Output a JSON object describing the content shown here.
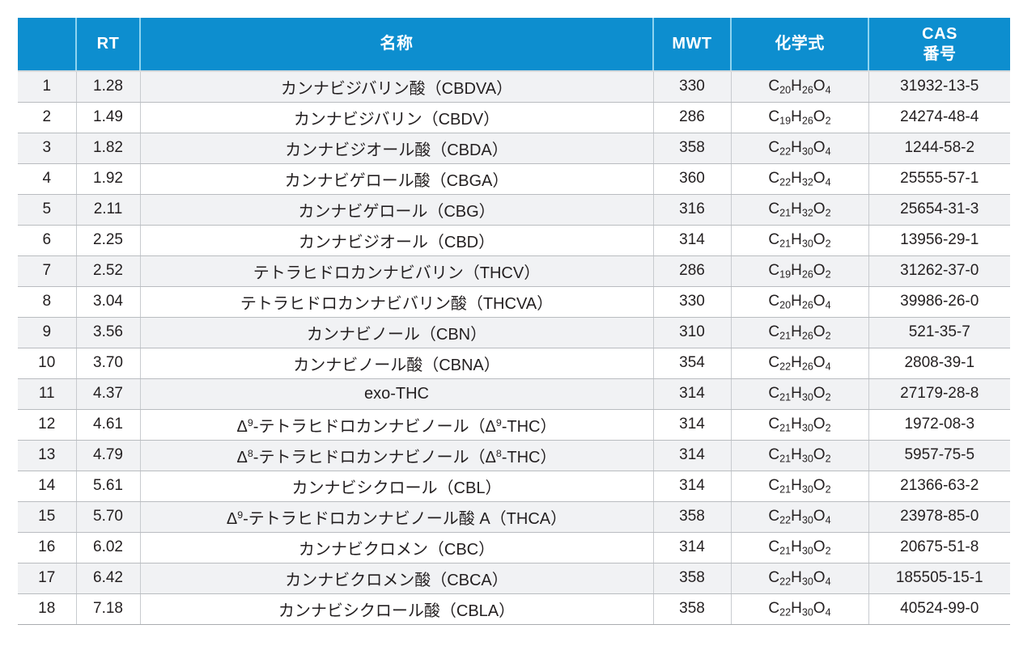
{
  "table": {
    "accent_color": "#0d8ecf",
    "header_divider_color": "#8fd4f0",
    "stripe_color": "#f1f2f4",
    "columns": [
      {
        "key": "no",
        "label": ""
      },
      {
        "key": "rt",
        "label": "RT"
      },
      {
        "key": "name",
        "label": "名称"
      },
      {
        "key": "mwt",
        "label": "MWT"
      },
      {
        "key": "formula",
        "label": "化学式"
      },
      {
        "key": "cas",
        "label_line1": "CAS",
        "label_line2": "番号"
      }
    ],
    "rows": [
      {
        "no": "1",
        "rt": "1.28",
        "name": "カンナビジバリン酸（CBDVA）",
        "mwt": "330",
        "formula": "C20H26O4",
        "formula_parts": [
          [
            "C",
            "20"
          ],
          [
            "H",
            "26"
          ],
          [
            "O",
            "4"
          ]
        ],
        "cas": "31932-13-5"
      },
      {
        "no": "2",
        "rt": "1.49",
        "name": "カンナビジバリン（CBDV）",
        "mwt": "286",
        "formula": "C19H26O2",
        "formula_parts": [
          [
            "C",
            "19"
          ],
          [
            "H",
            "26"
          ],
          [
            "O",
            "2"
          ]
        ],
        "cas": "24274-48-4"
      },
      {
        "no": "3",
        "rt": "1.82",
        "name": "カンナビジオール酸（CBDA）",
        "mwt": "358",
        "formula": "C22H30O4",
        "formula_parts": [
          [
            "C",
            "22"
          ],
          [
            "H",
            "30"
          ],
          [
            "O",
            "4"
          ]
        ],
        "cas": "1244-58-2"
      },
      {
        "no": "4",
        "rt": "1.92",
        "name": "カンナビゲロール酸（CBGA）",
        "mwt": "360",
        "formula": "C22H32O4",
        "formula_parts": [
          [
            "C",
            "22"
          ],
          [
            "H",
            "32"
          ],
          [
            "O",
            "4"
          ]
        ],
        "cas": "25555-57-1"
      },
      {
        "no": "5",
        "rt": "2.11",
        "name": "カンナビゲロール（CBG）",
        "mwt": "316",
        "formula": "C21H32O2",
        "formula_parts": [
          [
            "C",
            "21"
          ],
          [
            "H",
            "32"
          ],
          [
            "O",
            "2"
          ]
        ],
        "cas": "25654-31-3"
      },
      {
        "no": "6",
        "rt": "2.25",
        "name": "カンナビジオール（CBD）",
        "mwt": "314",
        "formula": "C21H30O2",
        "formula_parts": [
          [
            "C",
            "21"
          ],
          [
            "H",
            "30"
          ],
          [
            "O",
            "2"
          ]
        ],
        "cas": "13956-29-1"
      },
      {
        "no": "7",
        "rt": "2.52",
        "name": "テトラヒドロカンナビバリン（THCV）",
        "mwt": "286",
        "formula": "C19H26O2",
        "formula_parts": [
          [
            "C",
            "19"
          ],
          [
            "H",
            "26"
          ],
          [
            "O",
            "2"
          ]
        ],
        "cas": "31262-37-0"
      },
      {
        "no": "8",
        "rt": "3.04",
        "name": "テトラヒドロカンナビバリン酸（THCVA）",
        "mwt": "330",
        "formula": "C20H26O4",
        "formula_parts": [
          [
            "C",
            "20"
          ],
          [
            "H",
            "26"
          ],
          [
            "O",
            "4"
          ]
        ],
        "cas": "39986-26-0"
      },
      {
        "no": "9",
        "rt": "3.56",
        "name": "カンナビノール（CBN）",
        "mwt": "310",
        "formula": "C21H26O2",
        "formula_parts": [
          [
            "C",
            "21"
          ],
          [
            "H",
            "26"
          ],
          [
            "O",
            "2"
          ]
        ],
        "cas": "521-35-7"
      },
      {
        "no": "10",
        "rt": "3.70",
        "name": "カンナビノール酸（CBNA）",
        "mwt": "354",
        "formula": "C22H26O4",
        "formula_parts": [
          [
            "C",
            "22"
          ],
          [
            "H",
            "26"
          ],
          [
            "O",
            "4"
          ]
        ],
        "cas": "2808-39-1"
      },
      {
        "no": "11",
        "rt": "4.37",
        "name": "exo-THC",
        "mwt": "314",
        "formula": "C21H30O2",
        "formula_parts": [
          [
            "C",
            "21"
          ],
          [
            "H",
            "30"
          ],
          [
            "O",
            "2"
          ]
        ],
        "cas": "27179-28-8"
      },
      {
        "no": "12",
        "rt": "4.61",
        "name": "Δ9-テトラヒドロカンナビノール（Δ9-THC）",
        "name_html": "<span class=\"dlt\">Δ<span class=\"sup9\">9</span></span>-テトラヒドロカンナビノール（<span class=\"dlt\">Δ<span class=\"sup9\">9</span></span>-THC）",
        "mwt": "314",
        "formula": "C21H30O2",
        "formula_parts": [
          [
            "C",
            "21"
          ],
          [
            "H",
            "30"
          ],
          [
            "O",
            "2"
          ]
        ],
        "cas": "1972-08-3"
      },
      {
        "no": "13",
        "rt": "4.79",
        "name": "Δ8-テトラヒドロカンナビノール（Δ8-THC）",
        "name_html": "<span class=\"dlt\">Δ<span class=\"sup9\">8</span></span>-テトラヒドロカンナビノール（<span class=\"dlt\">Δ<span class=\"sup9\">8</span></span>-THC）",
        "mwt": "314",
        "formula": "C21H30O2",
        "formula_parts": [
          [
            "C",
            "21"
          ],
          [
            "H",
            "30"
          ],
          [
            "O",
            "2"
          ]
        ],
        "cas": "5957-75-5"
      },
      {
        "no": "14",
        "rt": "5.61",
        "name": "カンナビシクロール（CBL）",
        "mwt": "314",
        "formula": "C21H30O2",
        "formula_parts": [
          [
            "C",
            "21"
          ],
          [
            "H",
            "30"
          ],
          [
            "O",
            "2"
          ]
        ],
        "cas": "21366-63-2"
      },
      {
        "no": "15",
        "rt": "5.70",
        "name": "Δ9-テトラヒドロカンナビノール酸 A（THCA）",
        "name_html": "<span class=\"dlt\">Δ<span class=\"sup9\">9</span></span>-テトラヒドロカンナビノール酸 A（THCA）",
        "mwt": "358",
        "formula": "C22H30O4",
        "formula_parts": [
          [
            "C",
            "22"
          ],
          [
            "H",
            "30"
          ],
          [
            "O",
            "4"
          ]
        ],
        "cas": "23978-85-0"
      },
      {
        "no": "16",
        "rt": "6.02",
        "name": "カンナビクロメン（CBC）",
        "mwt": "314",
        "formula": "C21H30O2",
        "formula_parts": [
          [
            "C",
            "21"
          ],
          [
            "H",
            "30"
          ],
          [
            "O",
            "2"
          ]
        ],
        "cas": "20675-51-8"
      },
      {
        "no": "17",
        "rt": "6.42",
        "name": "カンナビクロメン酸（CBCA）",
        "mwt": "358",
        "formula": "C22H30O4",
        "formula_parts": [
          [
            "C",
            "22"
          ],
          [
            "H",
            "30"
          ],
          [
            "O",
            "4"
          ]
        ],
        "cas": "185505-15-1"
      },
      {
        "no": "18",
        "rt": "7.18",
        "name": "カンナビシクロール酸（CBLA）",
        "mwt": "358",
        "formula": "C22H30O4",
        "formula_parts": [
          [
            "C",
            "22"
          ],
          [
            "H",
            "30"
          ],
          [
            "O",
            "4"
          ]
        ],
        "cas": "40524-99-0"
      }
    ]
  }
}
